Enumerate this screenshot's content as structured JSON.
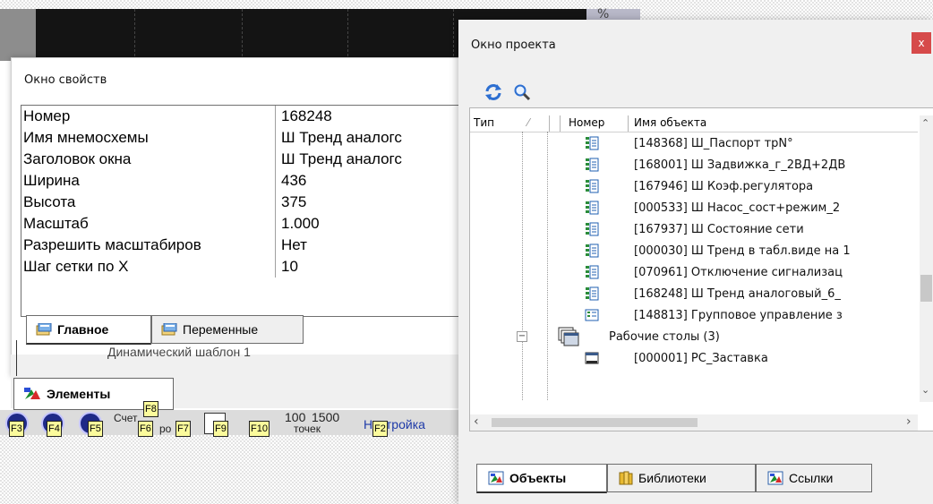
{
  "background": {
    "percent_sign": "%"
  },
  "properties_window": {
    "title": "Окно свойств",
    "rows": [
      {
        "name": "Номер",
        "value": "168248"
      },
      {
        "name": "Имя мнемосхемы",
        "value": "Ш Тренд аналогс"
      },
      {
        "name": "Заголовок окна",
        "value": "Ш Тренд аналогс"
      },
      {
        "name": "Ширина",
        "value": "436"
      },
      {
        "name": "Высота",
        "value": "375"
      },
      {
        "name": "Масштаб",
        "value": "1.000"
      },
      {
        "name": "Разрешить масштабиров",
        "value": "Нет"
      },
      {
        "name": "Шаг сетки по X",
        "value": "10"
      }
    ],
    "tabs": [
      {
        "label": "Главное",
        "active": true
      },
      {
        "label": "Переменные",
        "active": false
      }
    ]
  },
  "elements_panel": {
    "hint": "Динамический шаблон 1",
    "tab_label": "Элементы"
  },
  "fkey_bar": {
    "keys": [
      "F3",
      "F4",
      "F5",
      "F6",
      "F7",
      "F9",
      "F10",
      "F2"
    ],
    "f8_label": "F8",
    "text_schet": "Счет",
    "text_ro": "ро",
    "text_100": "100",
    "text_1500": "1500",
    "text_tochek": "точек",
    "text_nastroika": "Настройка"
  },
  "project_window": {
    "title": "Окно проекта",
    "close_label": "x",
    "columns": {
      "type": "Тип",
      "number": "Номер",
      "name": "Имя объекта"
    },
    "items": [
      {
        "text": "[148368] Ш_Паспорт трN°",
        "icon": "mnemo-list-icon"
      },
      {
        "text": "[168001] Ш Задвижка_г_2ВД+2ДВ",
        "icon": "mnemo-list-icon"
      },
      {
        "text": "[167946] Ш Коэф.регулятора",
        "icon": "mnemo-list-icon"
      },
      {
        "text": "[000533] Ш Насос_сост+режим_2",
        "icon": "mnemo-list-icon"
      },
      {
        "text": "[167937] Ш Состояние сети",
        "icon": "mnemo-list-icon"
      },
      {
        "text": "[000030] Ш Тренд в табл.виде на 1",
        "icon": "mnemo-list-icon"
      },
      {
        "text": "[070961] Отключение сигнализац",
        "icon": "mnemo-list-icon"
      },
      {
        "text": "[168248] Ш Тренд аналоговый_6_",
        "icon": "mnemo-list-icon"
      },
      {
        "text": "[148813] Групповое управление з",
        "icon": "mnemo-group-icon"
      }
    ],
    "group": {
      "label": "Рабочие столы (3)",
      "expander": "−"
    },
    "desktop_item": "[000001] РС_Заставка",
    "tabs": [
      {
        "label": "Объекты",
        "active": true
      },
      {
        "label": "Библиотеки",
        "active": false
      },
      {
        "label": "Ссылки",
        "active": false
      }
    ]
  }
}
